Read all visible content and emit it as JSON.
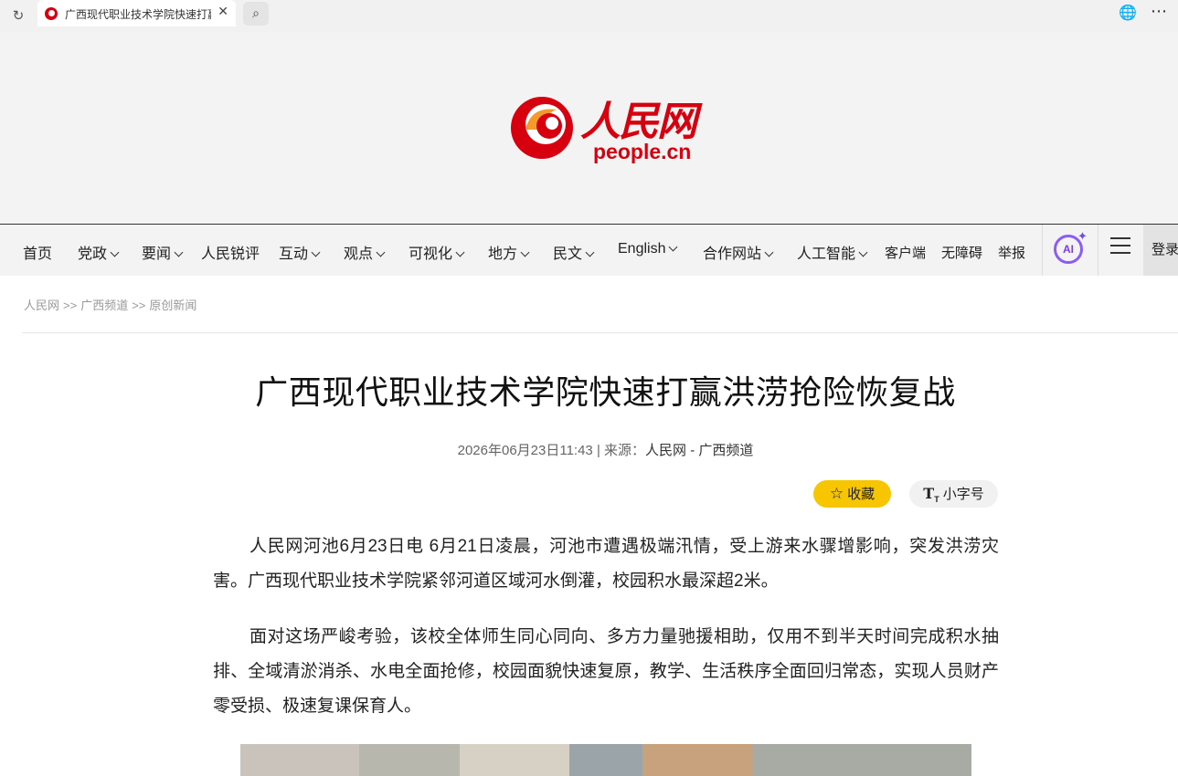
{
  "browser": {
    "tab_title": "广西现代职业技术学院快速打赢洪涝抢险恢复战",
    "tab_close": "✕",
    "reload_icon": "↻",
    "search_icon": "⌕",
    "globe_icon": "🌐",
    "more_icon": "⋯"
  },
  "logo": {
    "cn": "人民网",
    "en": "people.cn"
  },
  "nav": {
    "items": [
      {
        "label": "首页"
      },
      {
        "label": "党政"
      },
      {
        "label": "要闻"
      },
      {
        "label": "人民锐评"
      },
      {
        "label": "互动"
      },
      {
        "label": "观点"
      },
      {
        "label": "可视化"
      },
      {
        "label": "地方"
      },
      {
        "label": "民文"
      },
      {
        "label": "English"
      },
      {
        "label": "合作网站"
      },
      {
        "label": "人工智能"
      }
    ],
    "client": "客户端",
    "accessibility": "无障碍",
    "report": "举报",
    "ai_label": "AI",
    "ai_star": "✦",
    "login": "登录"
  },
  "breadcrumb": {
    "items": [
      "人民网",
      "广西频道",
      "原创新闻"
    ],
    "sep": ">>"
  },
  "article": {
    "title": "广西现代职业技术学院快速打赢洪涝抢险恢复战",
    "datetime": "2026年06月23日11:43",
    "divider": "|",
    "source_label": "来源：",
    "source": "人民网 - 广西频道",
    "favorite_label": "收藏",
    "favorite_icon": "☆",
    "font_size_label": "小字号",
    "font_icon_main": "T",
    "font_icon_sub": "T",
    "paragraphs": [
      "人民网河池6月23日电 6月21日凌晨，河池市遭遇极端汛情，受上游来水骤增影响，突发洪涝灾害。广西现代职业技术学院紧邻河道区域河水倒灌，校园积水最深超2米。",
      "面对这场严峻考验，该校全体师生同心同向、多方力量驰援相助，仅用不到半天时间完成积水抽排、全域清淤消杀、水电全面抢修，校园面貌快速复原，教学、生活秩序全面回归常态，实现人员财产零受损、极速复课保育人。"
    ]
  }
}
